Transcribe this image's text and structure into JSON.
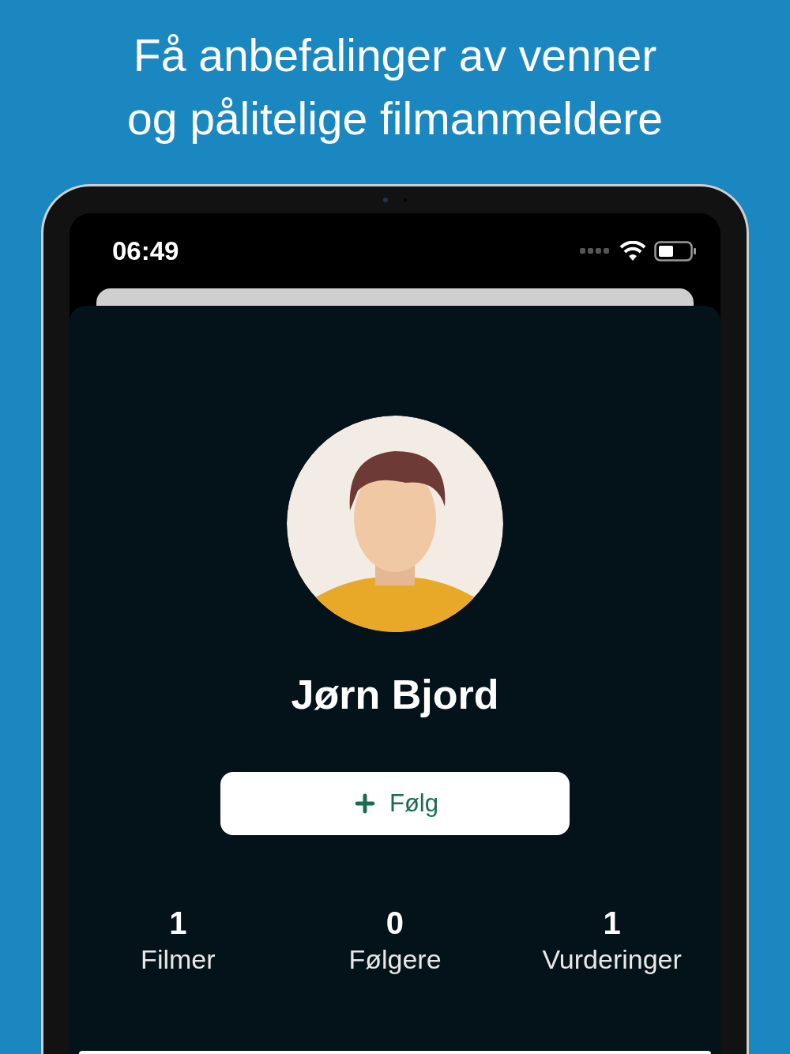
{
  "headline": [
    "Få anbefalinger av venner",
    "og pålitelige filmanmeldere"
  ],
  "status_bar": {
    "time": "06:49"
  },
  "profile": {
    "name": "Jørn Bjord",
    "follow_button": {
      "label": "Følg"
    }
  },
  "stats": [
    {
      "value": "1",
      "label": "Filmer"
    },
    {
      "value": "0",
      "label": "Følgere"
    },
    {
      "value": "1",
      "label": "Vurderinger"
    }
  ]
}
